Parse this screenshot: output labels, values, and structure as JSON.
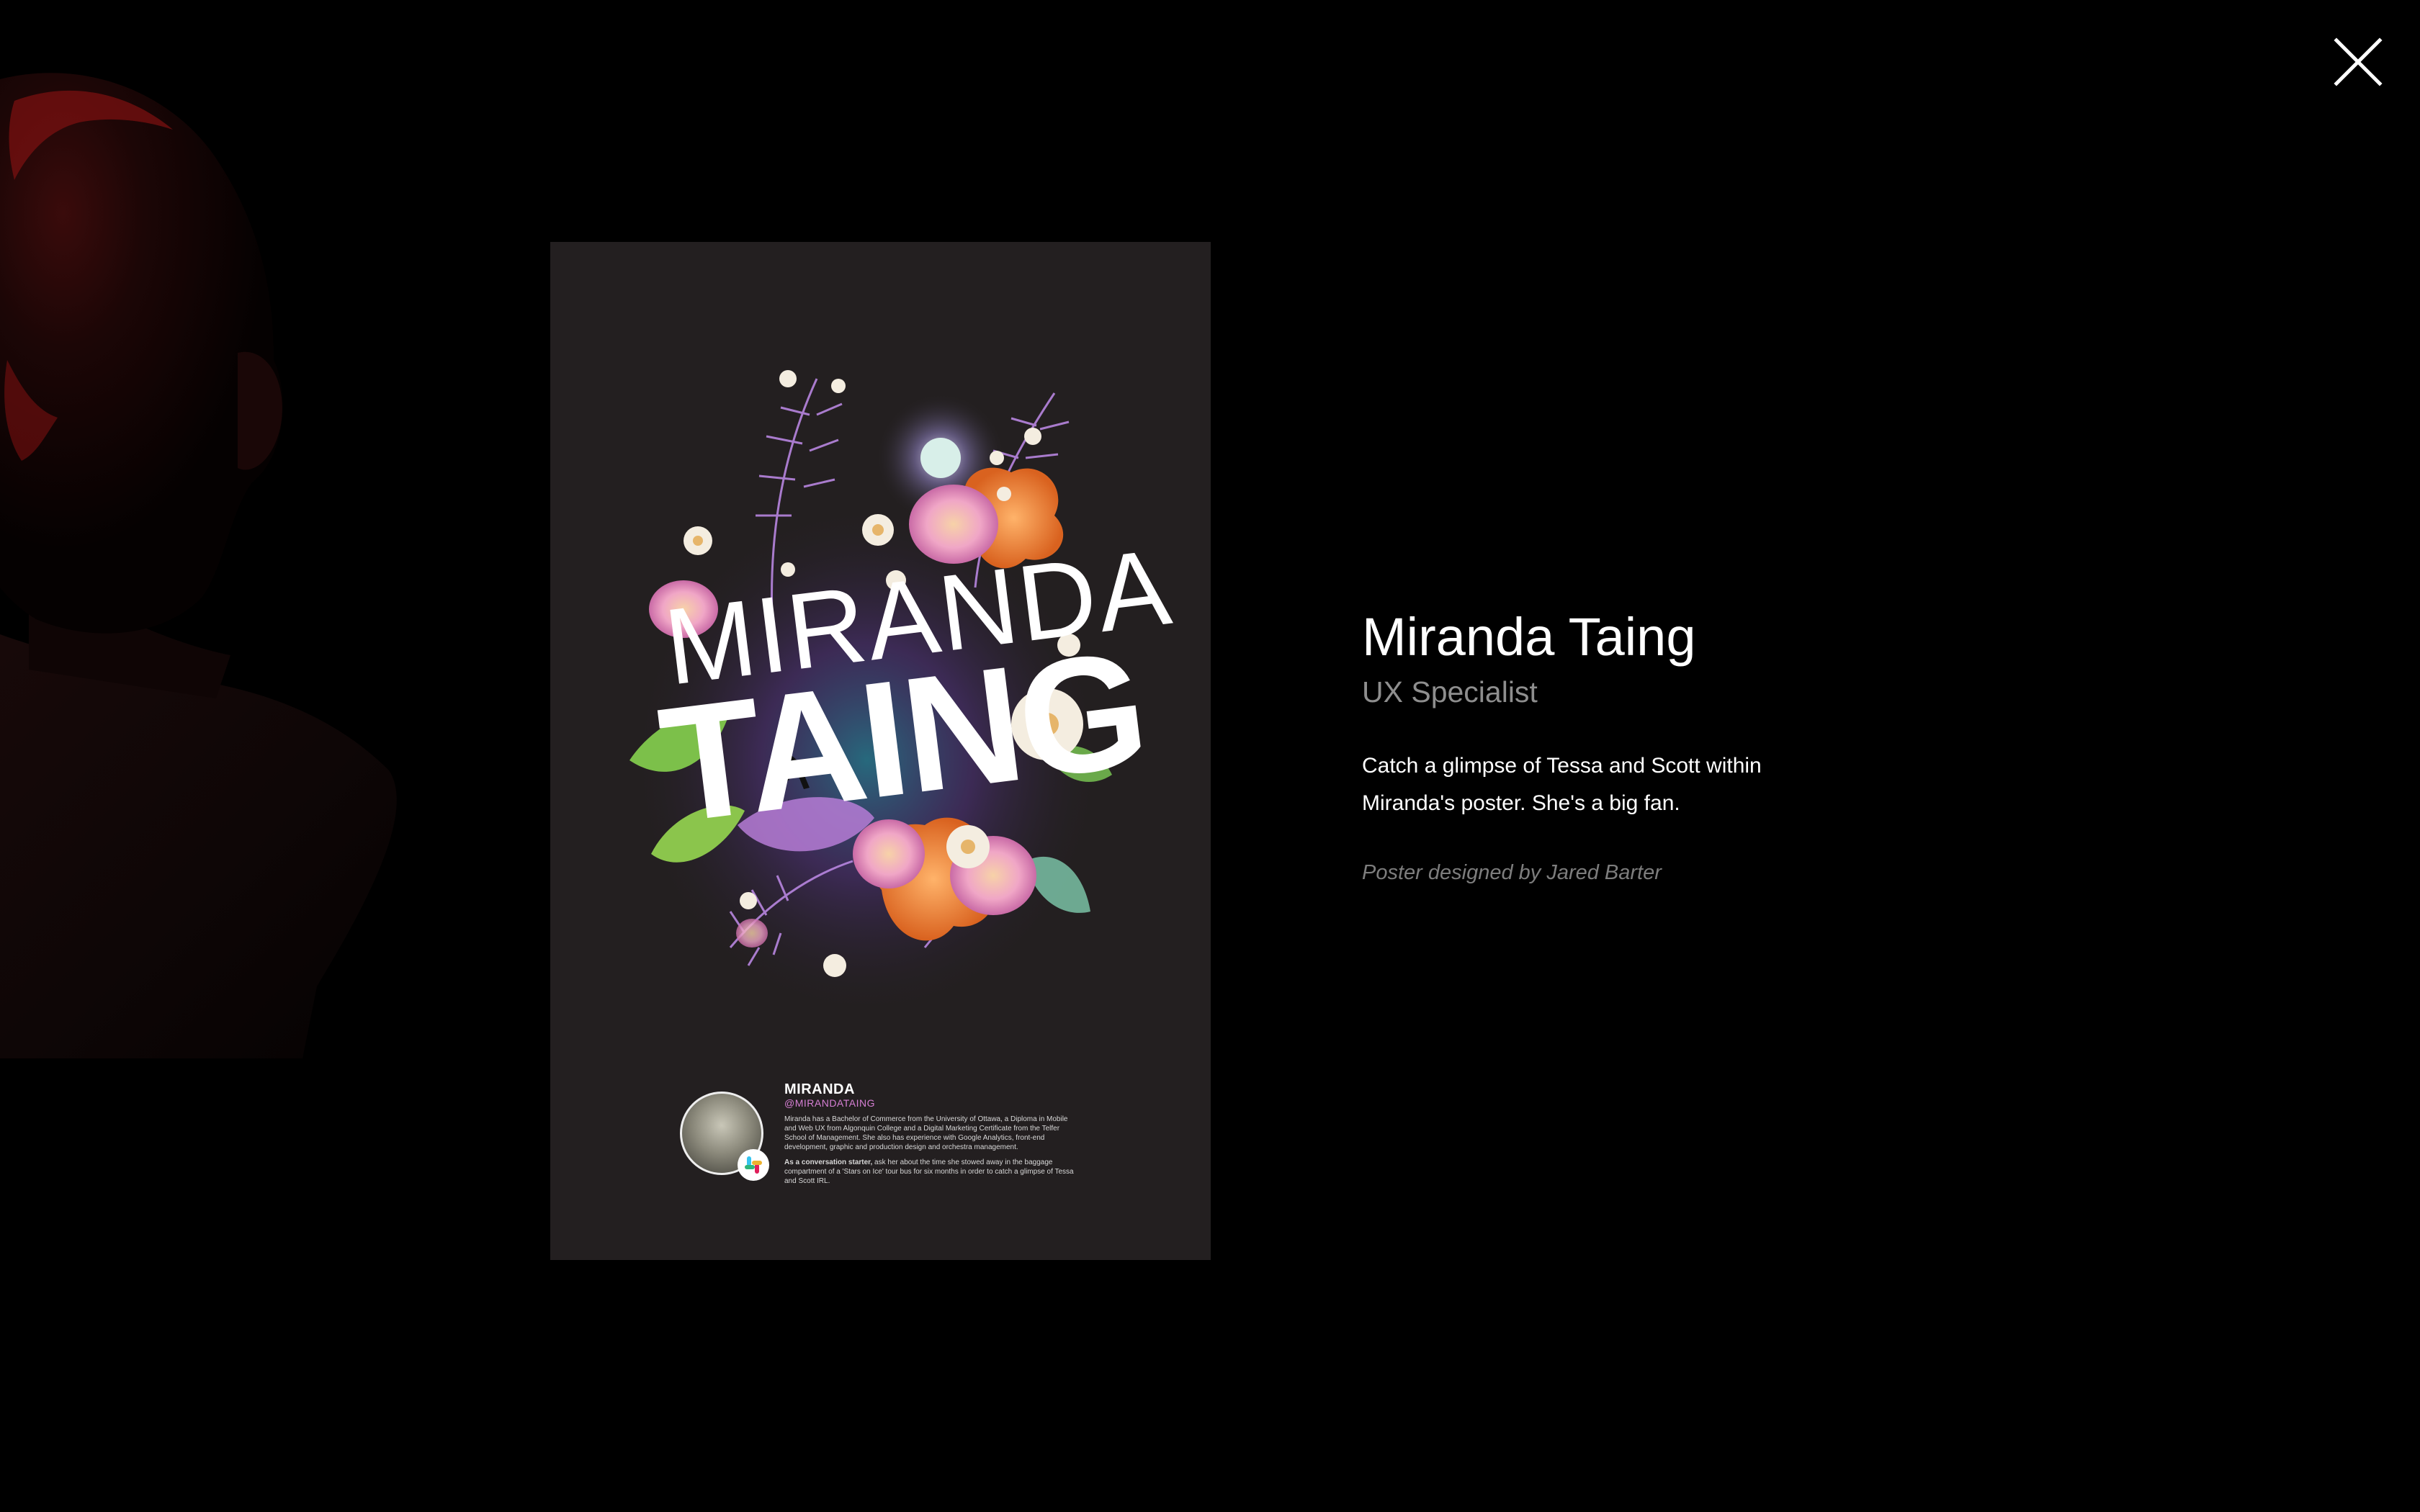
{
  "close": {
    "icon": "close-icon",
    "label": "Close"
  },
  "poster": {
    "title_line1": "MIRANDA",
    "title_line2": "TAING",
    "bio_name": "MIRANDA",
    "bio_handle": "@MIRANDATAING",
    "bio_paragraph1": "Miranda has a Bachelor of Commerce from the University of Ottawa, a Diploma in Mobile and Web UX from Algonquin College and a Digital Marketing Certificate from the Telfer School of Management. She also has experience with Google Analytics, front-end development, graphic and production design and orchestra management.",
    "bio_paragraph2_lead": "As a conversation starter,",
    "bio_paragraph2": " ask her about the time she stowed away in the baggage compartment of a 'Stars on Ice' tour bus for six months in order to catch a glimpse of Tessa and Scott IRL."
  },
  "profile": {
    "name": "Miranda Taing",
    "role": "UX Specialist",
    "description": "Catch a glimpse of Tessa and Scott within Miranda's poster. She's a big fan.",
    "credit": "Poster designed by Jared Barter"
  },
  "colors": {
    "background": "#000000",
    "poster_background": "#231f20",
    "role_text": "#8e8e8e",
    "credit_text": "#7d7d7d",
    "handle_accent": "#d67fd4"
  }
}
